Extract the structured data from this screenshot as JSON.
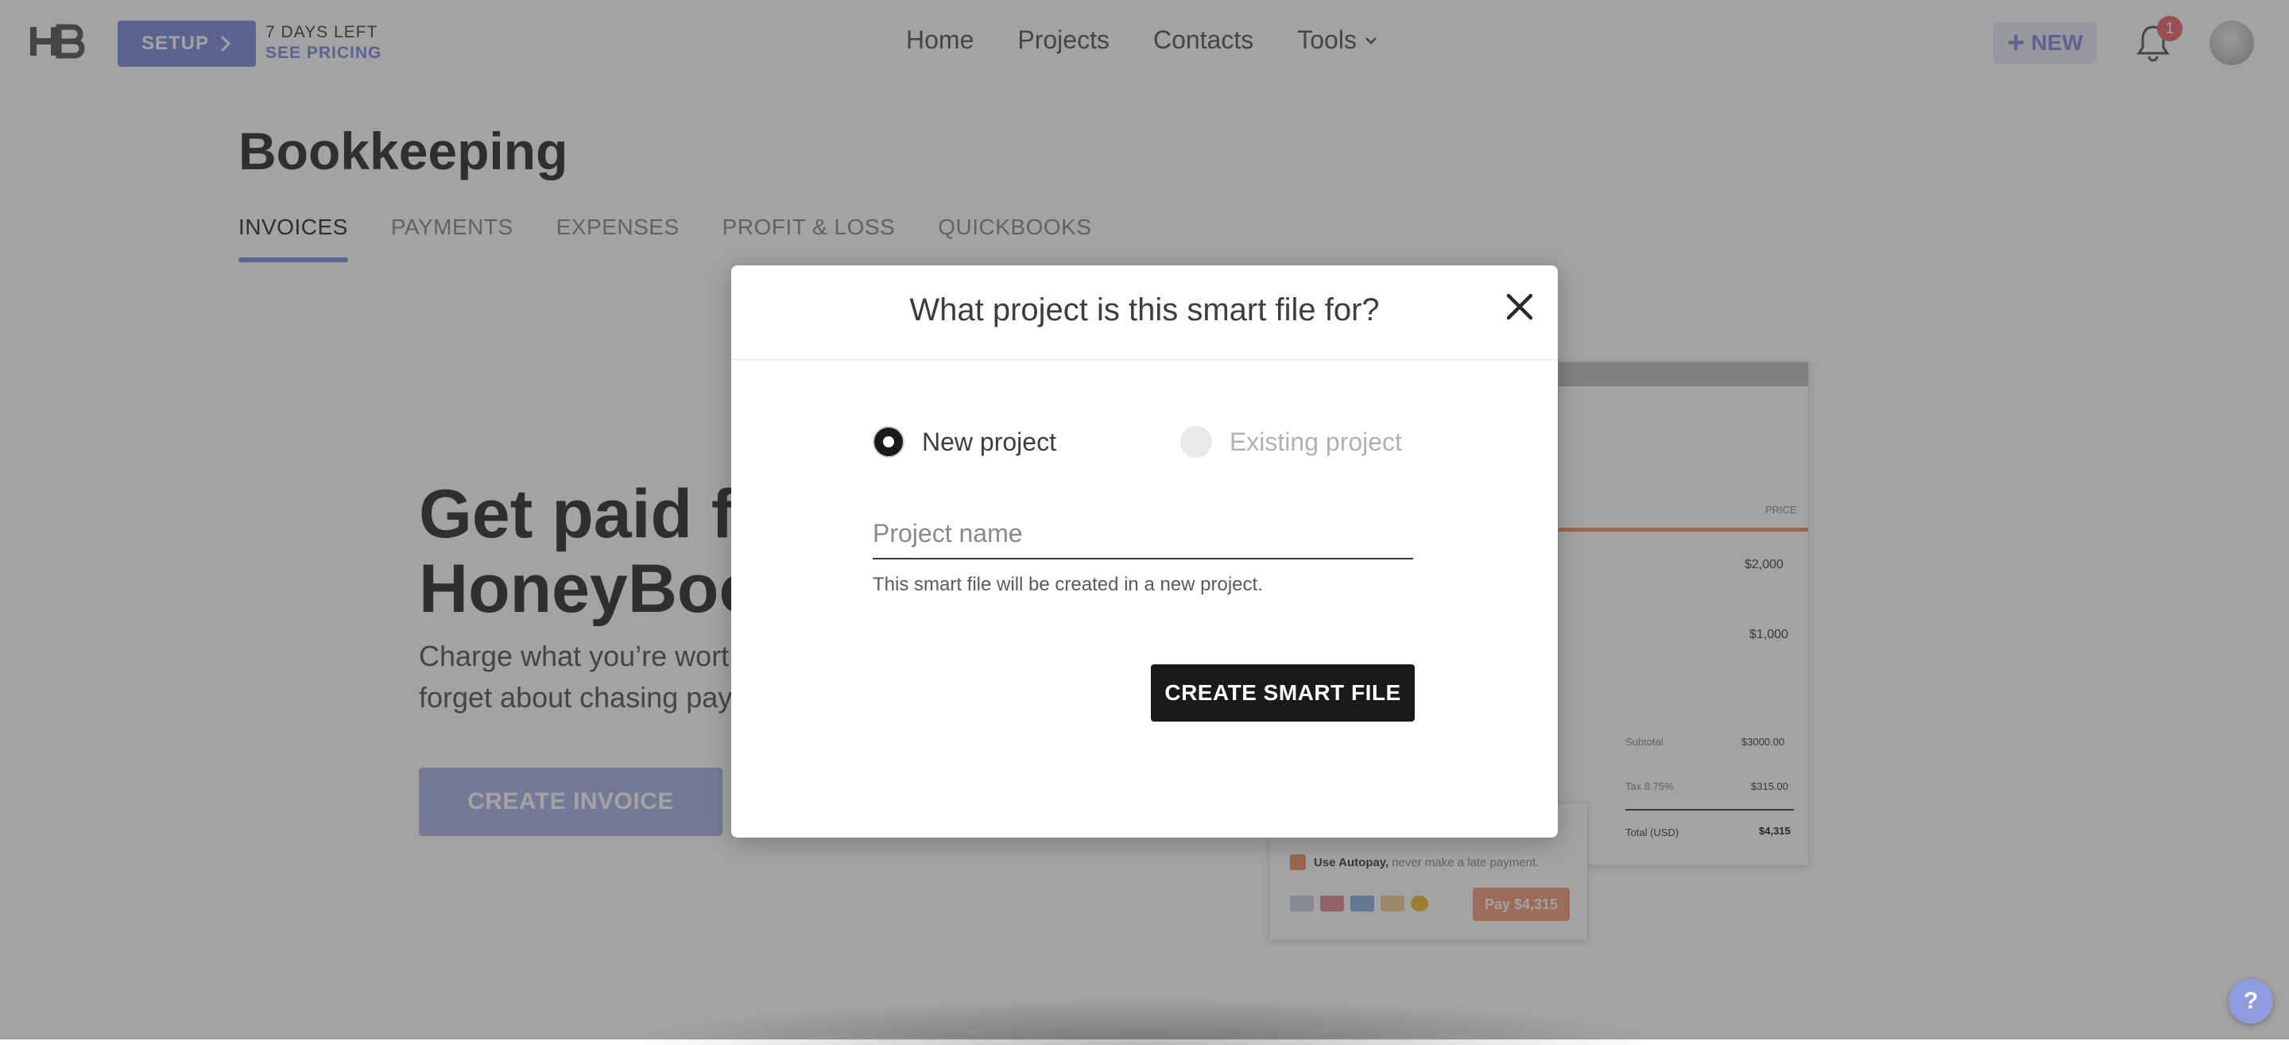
{
  "topbar": {
    "logo_text": "HB",
    "setup_label": "SETUP",
    "trial_days": "7 DAYS LEFT",
    "see_pricing": "SEE PRICING",
    "nav": [
      "Home",
      "Projects",
      "Contacts",
      "Tools"
    ],
    "new_label": "NEW",
    "notifications_count": "1"
  },
  "page": {
    "title": "Bookkeeping",
    "tabs": [
      "INVOICES",
      "PAYMENTS",
      "EXPENSES",
      "PROFIT & LOSS",
      "QUICKBOOKS"
    ],
    "active_tab": "INVOICES"
  },
  "hero": {
    "title_line1": "Get paid fa",
    "title_line2": "HoneyBool",
    "sub_line1": "Charge what you’re wort",
    "sub_line2": "forget about chasing pay",
    "cta": "CREATE INVOICE"
  },
  "preview": {
    "price_header": "PRICE",
    "line1": "$2,000",
    "line2": "$1,000",
    "subtotal_label": "Subtotal",
    "subtotal": "$3000.00",
    "tax_label": "Tax 8.75%",
    "tax": "$315.00",
    "total_label": "Total (USD)",
    "total": "$4,315",
    "autopay_label": "Use Autopay,",
    "autopay_hint": "never make a late payment.",
    "pay_button": "Pay $4,315"
  },
  "modal": {
    "title": "What project is this smart file for?",
    "option_new": "New project",
    "option_existing": "Existing project",
    "selected_option": "New project",
    "project_name_value": "",
    "project_name_placeholder": "Project name",
    "helper": "This smart file will be created in a new project.",
    "create_button": "CREATE SMART FILE"
  },
  "help_label": "?",
  "colors": {
    "accent": "#8f9ce0",
    "primary_button": "#1a1a1a",
    "invoice_accent": "#f0a07a",
    "badge": "#f07c7c"
  },
  "icons": [
    "hb-logo-icon",
    "chevron-right-icon",
    "chevron-down-icon",
    "plus-icon",
    "bell-icon",
    "close-icon",
    "help-icon"
  ]
}
